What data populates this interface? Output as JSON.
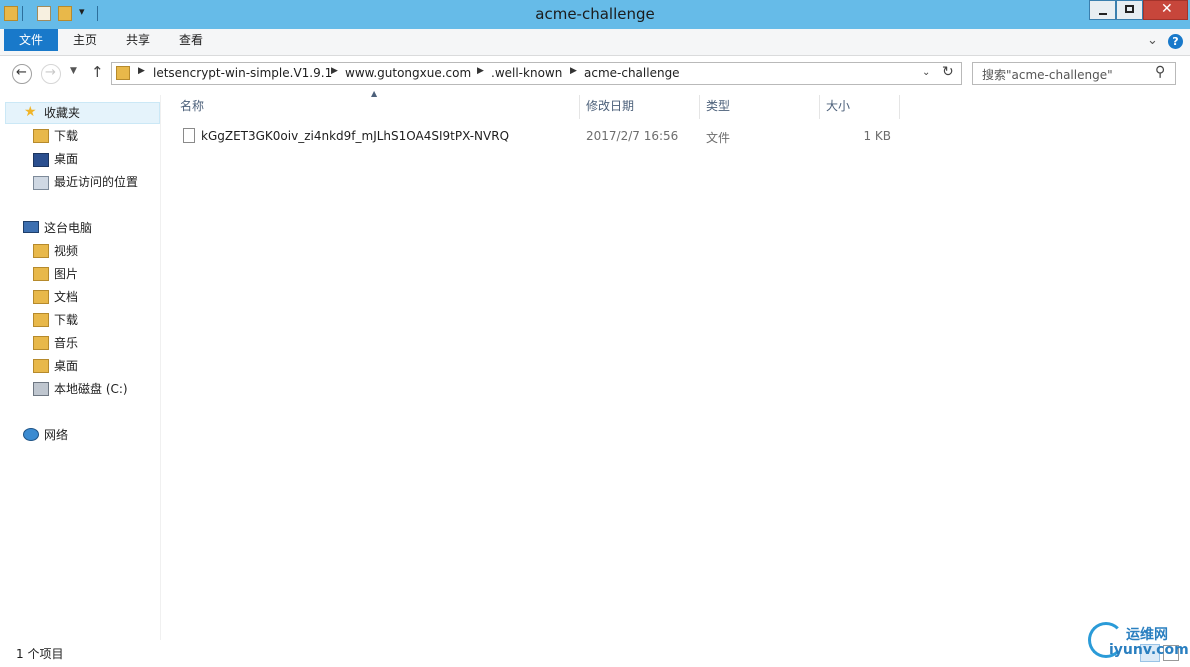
{
  "window": {
    "title": "acme-challenge"
  },
  "ribbon": {
    "tabs": [
      "文件",
      "主页",
      "共享",
      "查看"
    ]
  },
  "address": {
    "crumbs": [
      "letsencrypt-win-simple.V1.9.1",
      "www.gutongxue.com",
      ".well-known",
      "acme-challenge"
    ],
    "search_placeholder": "搜索\"acme-challenge\""
  },
  "nav": {
    "favorites": "收藏夹",
    "fav_items": [
      "下载",
      "桌面",
      "最近访问的位置"
    ],
    "this_pc": "这台电脑",
    "pc_items": [
      "视频",
      "图片",
      "文档",
      "下载",
      "音乐",
      "桌面",
      "本地磁盘 (C:)"
    ],
    "network": "网络"
  },
  "columns": {
    "name": "名称",
    "modified": "修改日期",
    "type": "类型",
    "size": "大小"
  },
  "files": [
    {
      "name": "kGgZET3GK0oiv_zi4nkd9f_mJLhS1OA4SI9tPX-NVRQ",
      "modified": "2017/2/7 16:56",
      "type": "文件",
      "size": "1 KB"
    }
  ],
  "status": {
    "count": "1 个项目"
  },
  "watermark": {
    "text1": "运维网",
    "text2": "iyunv.com"
  },
  "colors": {
    "titlebar": "#66bbe8",
    "file_tab": "#1979ca",
    "close": "#c7463b"
  }
}
